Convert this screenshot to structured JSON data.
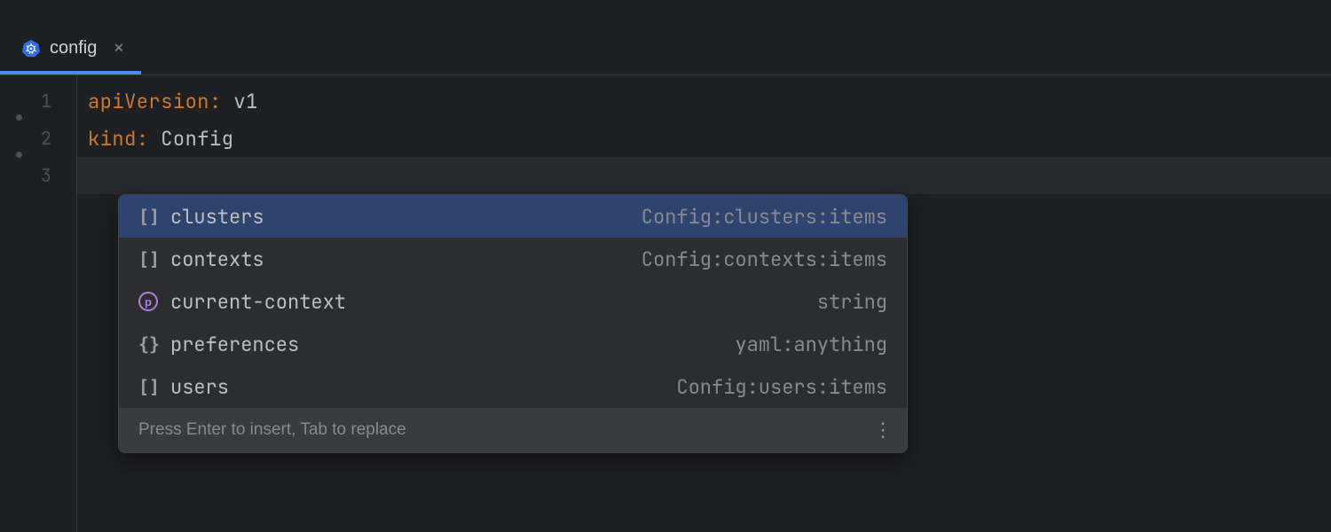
{
  "tab": {
    "title": "config",
    "close_glyph": "×"
  },
  "gutter": {
    "lines": [
      "1",
      "2",
      "3"
    ]
  },
  "code": {
    "line1": {
      "key": "apiVersion",
      "colon": ":",
      "value": "v1"
    },
    "line2": {
      "key": "kind",
      "colon": ":",
      "value": "Config"
    }
  },
  "completion": {
    "items": [
      {
        "icon": "[]",
        "label": "clusters",
        "type": "Config:clusters:items",
        "selected": true,
        "kind": "array"
      },
      {
        "icon": "[]",
        "label": "contexts",
        "type": "Config:contexts:items",
        "selected": false,
        "kind": "array"
      },
      {
        "icon": "p",
        "label": "current-context",
        "type": "string",
        "selected": false,
        "kind": "property"
      },
      {
        "icon": "{}",
        "label": "preferences",
        "type": "yaml:anything",
        "selected": false,
        "kind": "object"
      },
      {
        "icon": "[]",
        "label": "users",
        "type": "Config:users:items",
        "selected": false,
        "kind": "array"
      }
    ],
    "footer": "Press Enter to insert, Tab to replace",
    "kebab": "⋮"
  }
}
